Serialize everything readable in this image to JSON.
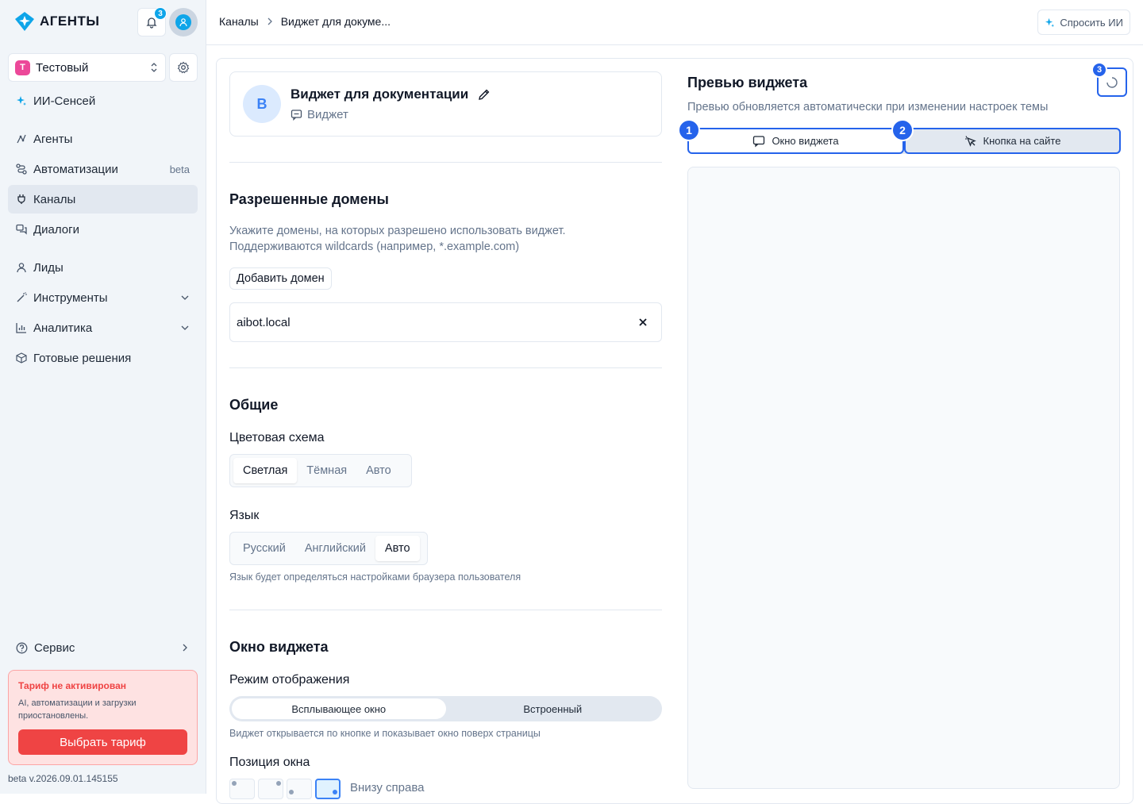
{
  "brand": {
    "name": "АГЕНТЫ",
    "logo_icon": "diamond-sparkle-icon"
  },
  "notifications": {
    "count": "3"
  },
  "workspace": {
    "letter": "Т",
    "name": "Тестовый"
  },
  "sidebar": {
    "ai_sensei": "ИИ-Сенсей",
    "items": [
      {
        "label": "Агенты",
        "icon": "agents-icon"
      },
      {
        "label": "Автоматизации",
        "badge": "beta",
        "icon": "automation-icon"
      },
      {
        "label": "Каналы",
        "icon": "plug-icon",
        "active": true
      },
      {
        "label": "Диалоги",
        "icon": "dialogs-icon"
      },
      {
        "label": "Лиды",
        "icon": "user-icon"
      },
      {
        "label": "Инструменты",
        "icon": "wand-icon",
        "expandable": true
      },
      {
        "label": "Аналитика",
        "icon": "chart-icon",
        "expandable": true
      },
      {
        "label": "Готовые решения",
        "icon": "box-icon"
      }
    ],
    "service": "Сервис"
  },
  "tariff": {
    "title": "Тариф не активирован",
    "text": "AI, автоматизации и загрузки приостановлены.",
    "button": "Выбрать тариф"
  },
  "version": "beta v.2026.09.01.145155",
  "breadcrumb": {
    "parent": "Каналы",
    "current": "Виджет для докуме..."
  },
  "ask_ai": "Спросить ИИ",
  "widget": {
    "avatar_letter": "В",
    "title": "Виджет для документации",
    "type": "Виджет"
  },
  "domains": {
    "title": "Разрешенные домены",
    "desc_line1": "Укажите домены, на которых разрешено использовать виджет.",
    "desc_line2": "Поддерживаются wildcards (например, *.example.com)",
    "add_button": "Добавить домен",
    "list": [
      "aibot.local"
    ]
  },
  "general": {
    "title": "Общие",
    "color_scheme_label": "Цветовая схема",
    "color_scheme_options": [
      "Светлая",
      "Тёмная",
      "Авто"
    ],
    "color_scheme_selected": "Светлая",
    "language_label": "Язык",
    "language_options": [
      "Русский",
      "Английский",
      "Авто"
    ],
    "language_selected": "Авто",
    "language_hint": "Язык будет определяться настройками браузера пользователя"
  },
  "window": {
    "title": "Окно виджета",
    "mode_label": "Режим отображения",
    "mode_options": [
      "Всплывающее окно",
      "Встроенный"
    ],
    "mode_selected": "Всплывающее окно",
    "mode_hint": "Виджет открывается по кнопке и показывает окно поверх страницы",
    "position_label": "Позиция окна",
    "position_selected": "Внизу справа"
  },
  "preview": {
    "title": "Превью виджета",
    "subtitle": "Превью обновляется автоматически при изменении настроек темы",
    "tabs": [
      "Окно виджета",
      "Кнопка на сайте"
    ],
    "markers": [
      "1",
      "2",
      "3"
    ]
  },
  "colors": {
    "accent": "#2563eb",
    "danger": "#ef4444",
    "brand": "#0ea5e9"
  }
}
